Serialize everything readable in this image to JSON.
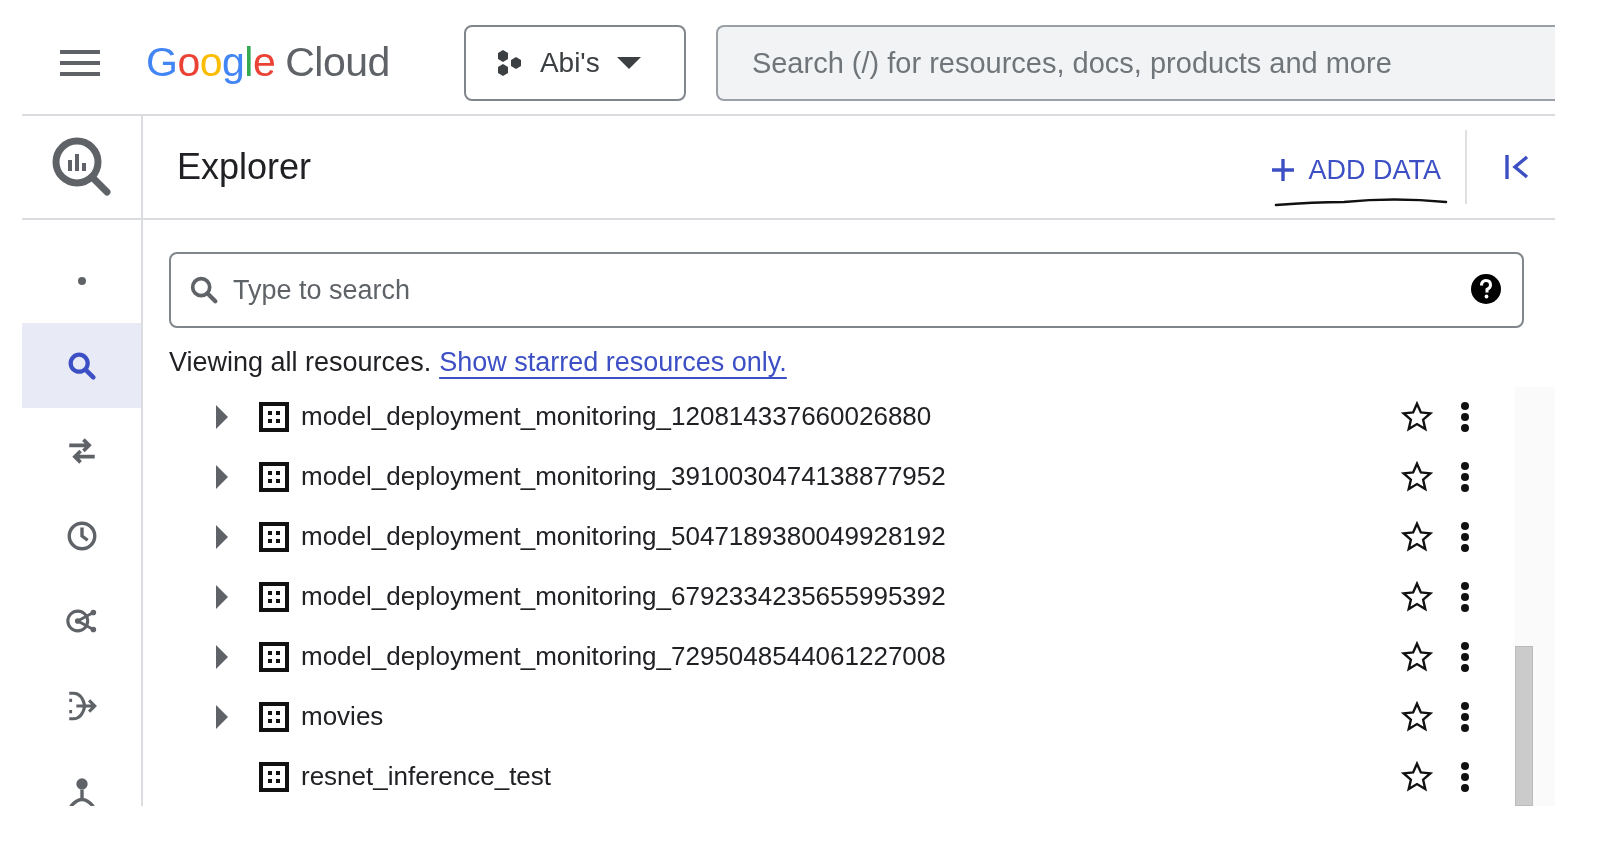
{
  "top_bar": {
    "logo": {
      "brand": "Google",
      "product": "Cloud"
    },
    "project": {
      "label": "Abi's"
    },
    "search": {
      "placeholder": "Search (/) for resources, docs, products and more"
    }
  },
  "sidebar": {
    "items": [
      {
        "kind": "dot",
        "selected": false
      },
      {
        "kind": "search",
        "selected": true
      },
      {
        "kind": "transfer",
        "selected": false
      },
      {
        "kind": "history",
        "selected": false
      },
      {
        "kind": "graph",
        "selected": false
      },
      {
        "kind": "flow",
        "selected": false
      },
      {
        "kind": "person",
        "selected": false
      }
    ]
  },
  "explorer": {
    "title": "Explorer",
    "add_button": "ADD DATA",
    "search": {
      "placeholder": "Type to search"
    },
    "notice": "Viewing all resources.",
    "notice_link": "Show starred resources only.",
    "rows": [
      {
        "name": "model_deployment_monitoring_120814337660026880",
        "expanded": false,
        "starred": false
      },
      {
        "name": "model_deployment_monitoring_3910030474138877952",
        "expanded": false,
        "starred": false
      },
      {
        "name": "model_deployment_monitoring_5047189380049928192",
        "expanded": false,
        "starred": false
      },
      {
        "name": "model_deployment_monitoring_6792334235655995392",
        "expanded": false,
        "starred": false
      },
      {
        "name": "model_deployment_monitoring_7295048544061227008",
        "expanded": false,
        "starred": false
      },
      {
        "name": "movies",
        "expanded": false,
        "starred": false
      },
      {
        "name": "resnet_inference_test",
        "starred": false
      }
    ]
  }
}
